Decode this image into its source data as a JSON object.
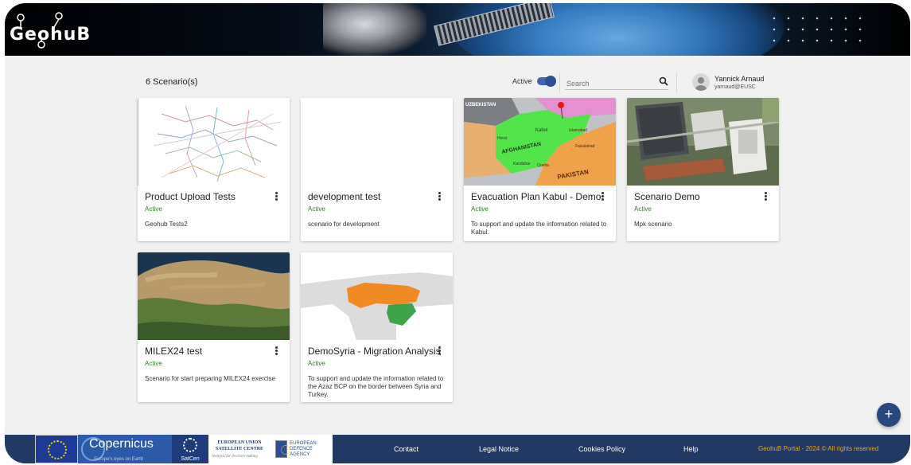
{
  "app": {
    "logo_text": "GeohuB"
  },
  "toolbar": {
    "scenario_count": "6 Scenario(s)",
    "active_label": "Active",
    "search_placeholder": "Search",
    "user_name": "Yannick Arnaud",
    "user_email": "yarnaud@EUSC"
  },
  "cards": [
    {
      "title": "Product Upload Tests",
      "status": "Active",
      "description": "Geohub Tests2",
      "thumbnail": "network-map"
    },
    {
      "title": "development test",
      "status": "Active",
      "description": "scenario for development",
      "thumbnail": "blank"
    },
    {
      "title": "Evacuation Plan Kabul - Demo",
      "status": "Active",
      "description": "To support and update the information related to Kabul.",
      "thumbnail": "afghanistan-map"
    },
    {
      "title": "Scenario Demo",
      "status": "Active",
      "description": "Mpk scenario",
      "thumbnail": "aerial-photo"
    },
    {
      "title": "MILEX24 test",
      "status": "Active",
      "description": "Scenario for start preparing MILEX24 exercise",
      "thumbnail": "satellite-africa"
    },
    {
      "title": "DemoSyria - Migration Analysis",
      "status": "Active",
      "description": "To support and update the information related to the Azaz BCP on the border between Syria and Turkey.",
      "thumbnail": "turkey-syria-map"
    }
  ],
  "map_labels": {
    "uzbekistan": "UZBEKISTAN",
    "afghanistan": "AFGHANISTAN",
    "pakistan": "PAKISTAN",
    "kabul": "Kabul",
    "herat": "Herat",
    "kandahar": "Kandahar",
    "islamabad": "Islamabad",
    "quetta": "Quetta",
    "faisalabad": "Faisalabad"
  },
  "footer": {
    "links": [
      "Contact",
      "Legal Notice",
      "Cookies Policy",
      "Help"
    ],
    "copyright": "GeohuB Portal - 2024 © All rights reserved",
    "partner_copernicus": "Copernicus",
    "partner_copernicus_tagline": "Europe's eyes on Earth",
    "partner_satcen": "SatCen",
    "partner_satcen_name": "EUROPEAN UNION SATELLITE CENTRE",
    "partner_satcen_tagline": "Analysis for decision making",
    "partner_eda": "EUROPEAN DEFENCE AGENCY"
  },
  "fab": {
    "label": "+"
  },
  "colors": {
    "accent": "#29467d",
    "status_active": "#2f7d27",
    "footer_bg": "#223a63",
    "copyright": "#e6a41e"
  }
}
